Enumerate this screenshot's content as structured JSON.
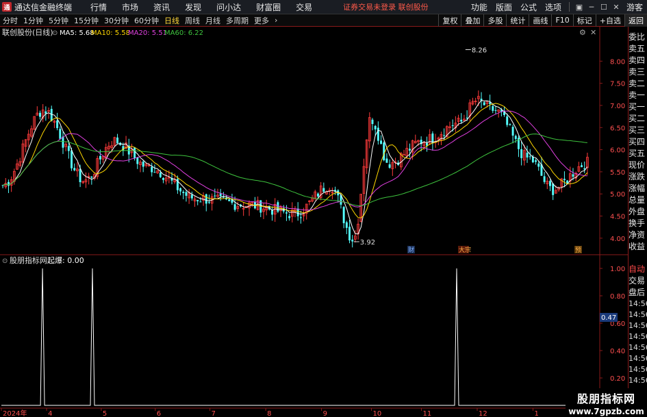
{
  "menubar": {
    "title": "通达信金融终端",
    "items": [
      "行情",
      "市场",
      "资讯",
      "发现",
      "问小达",
      "财富圈",
      "交易"
    ],
    "login_notice": "证券交易未登录  联创股份",
    "right_items": [
      "功能",
      "版面",
      "公式",
      "选项"
    ],
    "guest": "游客"
  },
  "periodbar": {
    "periods": [
      "分时",
      "1分钟",
      "5分钟",
      "15分钟",
      "30分钟",
      "60分钟",
      "日线",
      "周线",
      "月线",
      "多周期",
      "更多"
    ],
    "active": "日线",
    "tools": [
      "复权",
      "叠加",
      "多股",
      "统计",
      "画线",
      "F10",
      "标记",
      "+自选",
      "返回"
    ]
  },
  "main_chart": {
    "stock": "联创股份(日线)",
    "ma": [
      {
        "label": "MA5: 5.68",
        "color": "#ffffff"
      },
      {
        "label": "MA10: 5.58",
        "color": "#ffd700"
      },
      {
        "label": "MA20: 5.51",
        "color": "#e040e0"
      },
      {
        "label": "MA60: 6.22",
        "color": "#3ec43e"
      }
    ],
    "price_ticks": [
      "8.00",
      "7.50",
      "7.00",
      "6.50",
      "6.00",
      "5.50",
      "5.00",
      "4.50",
      "4.00"
    ],
    "ylim": [
      3.75,
      8.5
    ],
    "high_label": "8.26",
    "low_label": "3.92",
    "markers": [
      "财",
      "大宗",
      "预"
    ]
  },
  "indicator": {
    "name": "股朋指标网",
    "value_label": "起爆: 0.00",
    "ticks": [
      "1.00",
      "0.80",
      "0.60",
      "0.40",
      "0.20"
    ],
    "cursor_value": "0.47",
    "spikes": [
      0.07,
      0.155,
      0.775
    ]
  },
  "x_axis": {
    "labels": [
      "2024年",
      "4",
      "5",
      "6",
      "7",
      "8",
      "9",
      "10",
      "11",
      "12",
      "1"
    ]
  },
  "side_panel": {
    "upper": [
      "委比",
      "卖五",
      "卖四",
      "卖三",
      "卖二",
      "卖一",
      "买一",
      "买二",
      "买三",
      "买四",
      "买五",
      "现价",
      "涨跌",
      "涨幅",
      "总量",
      "外盘",
      "换手",
      "净资",
      "收益"
    ],
    "lower": [
      "自动",
      "交易",
      "盘后"
    ],
    "times": [
      "14:56",
      "14:56",
      "14:56",
      "14:56",
      "14:56",
      "14:56",
      "14:56",
      "14:56",
      "14:56",
      "14:56",
      "14:56"
    ]
  },
  "watermark": {
    "line1": "股朋指标网",
    "line2": "www.7gpzb.com"
  },
  "chart_data": {
    "type": "candlestick",
    "xlabels": [
      "2024年",
      "4",
      "5",
      "6",
      "7",
      "8",
      "9",
      "10",
      "11",
      "12",
      "1"
    ],
    "ylim": [
      3.75,
      8.5
    ],
    "key_points": [
      {
        "x": 0.0,
        "y": 5.2
      },
      {
        "x": 0.07,
        "y": 6.9
      },
      {
        "x": 0.14,
        "y": 5.3
      },
      {
        "x": 0.19,
        "y": 6.2
      },
      {
        "x": 0.25,
        "y": 5.6
      },
      {
        "x": 0.33,
        "y": 4.9
      },
      {
        "x": 0.42,
        "y": 4.75
      },
      {
        "x": 0.5,
        "y": 4.55
      },
      {
        "x": 0.56,
        "y": 5.2
      },
      {
        "x": 0.6,
        "y": 3.98
      },
      {
        "x": 0.63,
        "y": 6.7
      },
      {
        "x": 0.66,
        "y": 5.7
      },
      {
        "x": 0.72,
        "y": 6.2
      },
      {
        "x": 0.78,
        "y": 6.6
      },
      {
        "x": 0.81,
        "y": 7.1
      },
      {
        "x": 0.84,
        "y": 6.9
      },
      {
        "x": 0.9,
        "y": 5.8
      },
      {
        "x": 0.94,
        "y": 5.1
      },
      {
        "x": 1.0,
        "y": 5.7
      }
    ]
  }
}
